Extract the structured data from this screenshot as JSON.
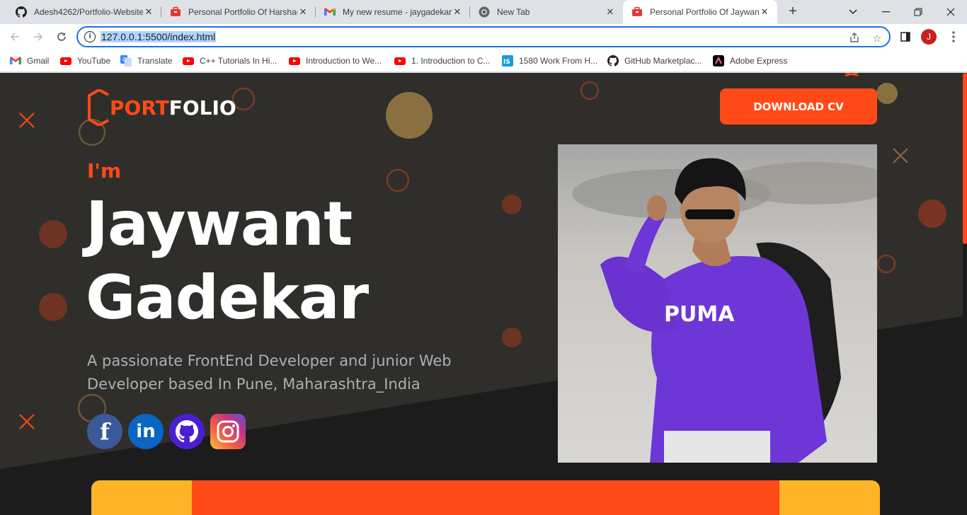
{
  "browser": {
    "tabs": [
      {
        "title": "Adesh4262/Portfolio-Website",
        "icon": "github-icon",
        "active": false
      },
      {
        "title": "Personal Portfolio Of Harshad",
        "icon": "briefcase-icon",
        "active": false
      },
      {
        "title": "My new resume - jaygadekar",
        "icon": "gmail-icon",
        "active": false
      },
      {
        "title": "New Tab",
        "icon": "chrome-icon",
        "active": false
      },
      {
        "title": "Personal Portfolio Of Jaywant",
        "icon": "briefcase-icon",
        "active": true
      }
    ],
    "new_tab": "+",
    "url": "127.0.0.1:5500/index.html",
    "profile_initial": "J",
    "bookmarks": [
      {
        "label": "Gmail",
        "icon": "gmail-icon"
      },
      {
        "label": "YouTube",
        "icon": "youtube-icon"
      },
      {
        "label": "Translate",
        "icon": "translate-icon"
      },
      {
        "label": "C++ Tutorials In Hi...",
        "icon": "youtube-icon"
      },
      {
        "label": "Introduction to We...",
        "icon": "youtube-icon"
      },
      {
        "label": "1. Introduction to C...",
        "icon": "youtube-icon"
      },
      {
        "label": "1580 Work From H...",
        "icon": "is-icon"
      },
      {
        "label": "GitHub Marketplac...",
        "icon": "github-icon"
      },
      {
        "label": "Adobe Express",
        "icon": "adobe-express-icon"
      }
    ]
  },
  "site": {
    "logo_part1": "PORT",
    "logo_part2": "FOLIO",
    "download_cv": "DOWNLOAD CV",
    "greeting": "I'm",
    "first_name": "Jaywant",
    "last_name": "Gadekar",
    "description": "A passionate FrontEnd Developer and junior Web Developer based In Pune, Maharashtra_India",
    "social": [
      {
        "name": "facebook",
        "glyph": "f"
      },
      {
        "name": "linkedin",
        "glyph": "in"
      },
      {
        "name": "github"
      },
      {
        "name": "instagram"
      }
    ],
    "shirt_text": "PUMA",
    "colors": {
      "accent": "#ff4a17",
      "dark": "#2f2e2b",
      "darker": "#1c1c1c",
      "gold": "#ffb326"
    }
  }
}
